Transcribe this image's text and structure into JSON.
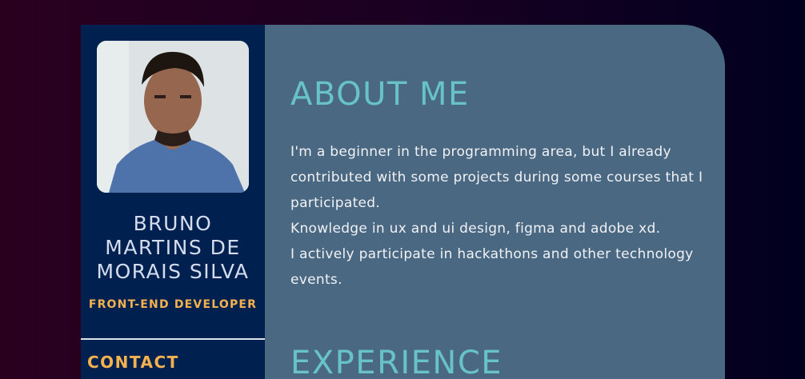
{
  "profile": {
    "name": "BRUNO MARTINS DE MORAIS SILVA",
    "role": "FRONT-END DEVELOPER",
    "contact_label": "CONTACT"
  },
  "about": {
    "title": "ABOUT ME",
    "paragraphs": [
      "I'm a beginner in the programming area, but I already contributed with some projects during some courses that I participated.",
      "Knowledge in ux and ui design, figma and adobe xd.",
      "I actively participate in hackathons and other technology events."
    ]
  },
  "experience": {
    "title": "EXPERIENCE"
  },
  "colors": {
    "sidebar_bg": "#002050",
    "main_bg": "#4a6882",
    "accent_teal": "#67c3c8",
    "accent_orange": "#f4b24f"
  }
}
